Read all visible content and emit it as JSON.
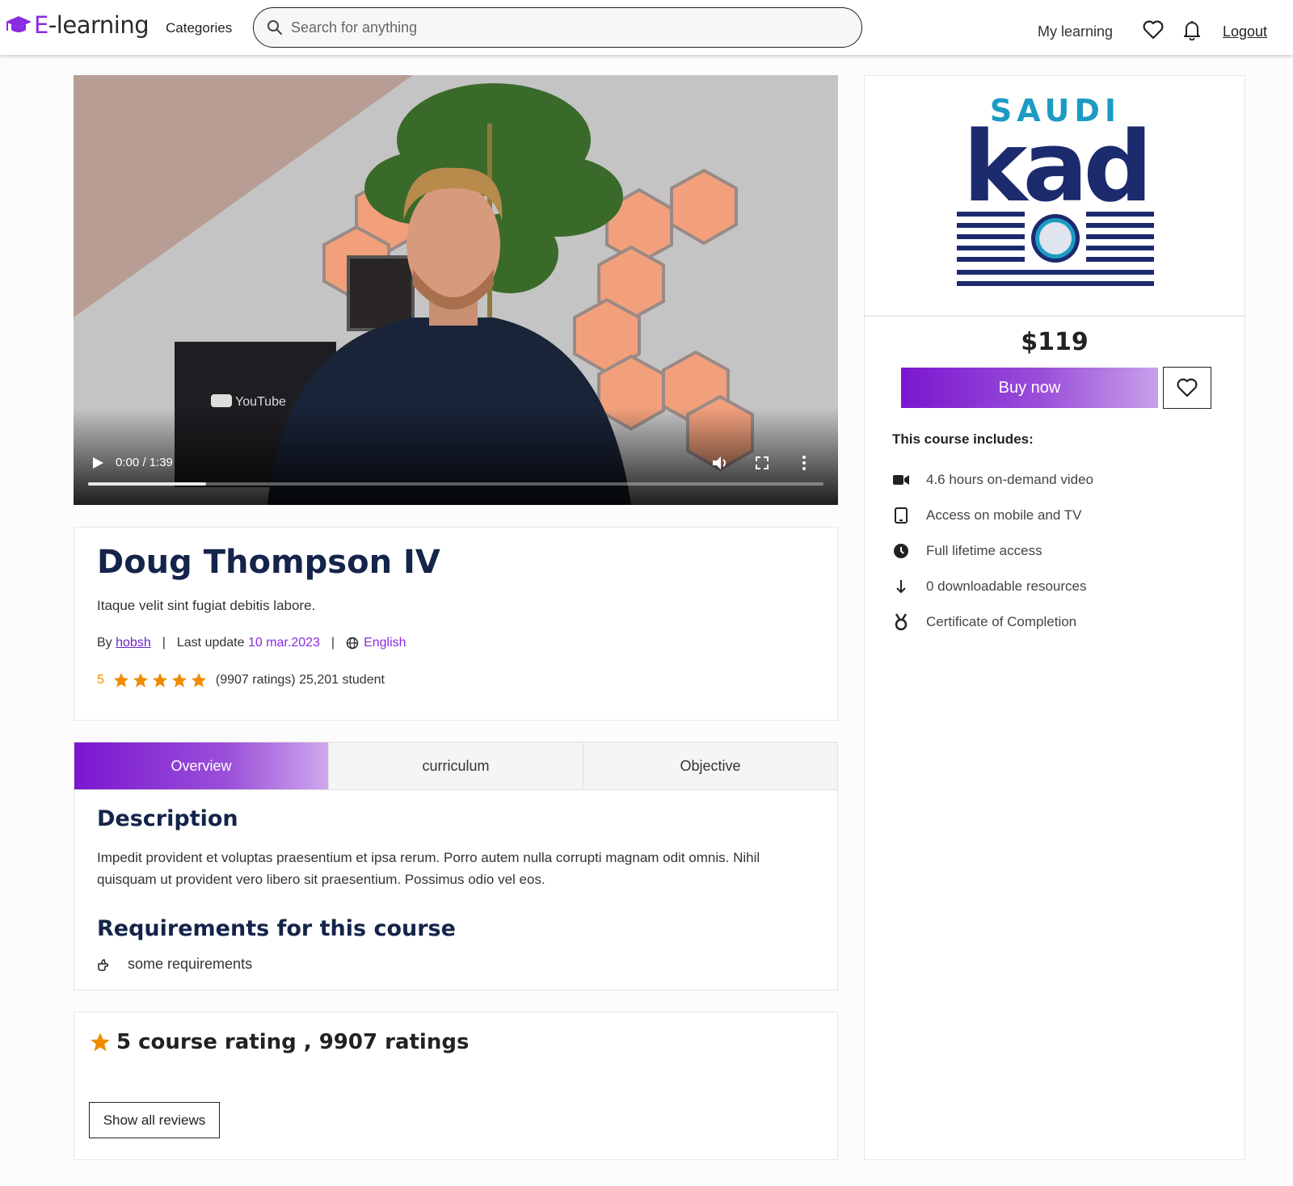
{
  "brand": {
    "text_e": "E",
    "text_rest": "-learning",
    "color": "#8a2be2"
  },
  "header": {
    "categories": "Categories",
    "search_placeholder": "Search for anything",
    "my_learning": "My learning",
    "logout": "Logout",
    "icons": [
      "heart-icon",
      "bell-icon"
    ]
  },
  "video": {
    "time": "0:00 / 1:39",
    "progress": 0.16,
    "watermark": "YouTube"
  },
  "course": {
    "title": "Doug Thompson IV",
    "subtitle": "Itaque velit sint fugiat debitis labore.",
    "by_label": "By",
    "author": "hobsh",
    "sep": "|",
    "last_update_label": "Last update",
    "last_update": "10 mar.2023",
    "language": "English",
    "rating": "5",
    "stars": 5,
    "ratings_text": "(9907 ratings) 25,201 student"
  },
  "tabs": [
    {
      "label": "Overview",
      "active": true
    },
    {
      "label": "curriculum",
      "active": false
    },
    {
      "label": "Objective",
      "active": false
    }
  ],
  "overview": {
    "description_heading": "Description",
    "description": "Impedit provident et voluptas praesentium et ipsa rerum. Porro autem nulla corrupti magnam odit omnis. Nihil quisquam ut provident vero libero sit praesentium. Possimus odio vel eos.",
    "requirements_heading": "Requirements for this course",
    "requirements": [
      "some requirements"
    ]
  },
  "reviews": {
    "summary": "5 course rating , 9907 ratings",
    "show_all": "Show all reviews"
  },
  "sidebar": {
    "logo_text_top": "SAUDI",
    "logo_text_main": "kad",
    "price": "$119",
    "buy_now": "Buy now",
    "includes_title": "This course includes:",
    "includes": [
      {
        "icon": "video-icon",
        "text": "4.6 hours on-demand video"
      },
      {
        "icon": "mobile-icon",
        "text": "Access on mobile and TV"
      },
      {
        "icon": "clock-icon",
        "text": "Full lifetime access"
      },
      {
        "icon": "download-icon",
        "text": "0 downloadable resources"
      },
      {
        "icon": "medal-icon",
        "text": "Certificate of Completion"
      }
    ]
  },
  "colors": {
    "accent": "#8a2be2",
    "title_navy": "#14244a",
    "star_orange": "#f08c00"
  }
}
